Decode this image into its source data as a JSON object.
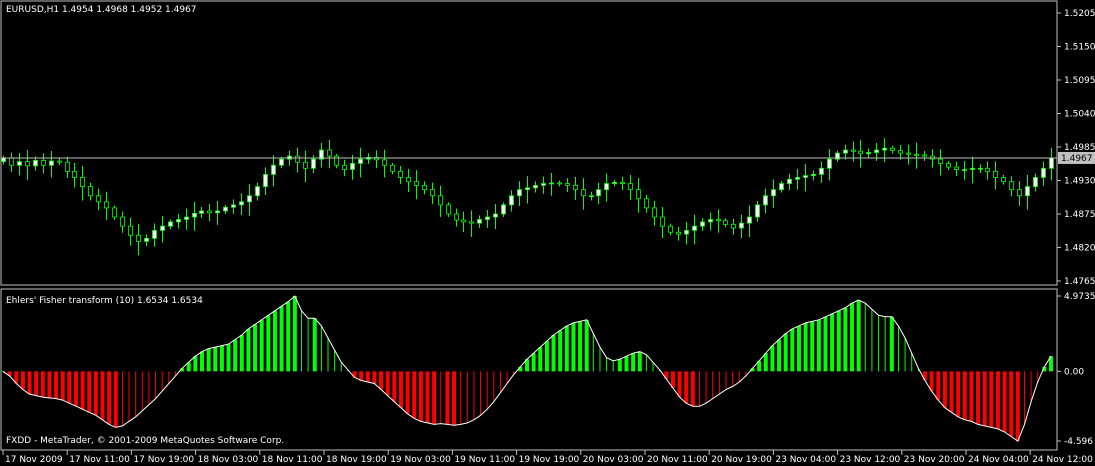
{
  "symbol_info": "EURUSD,H1  1.4954 1.4968 1.4952 1.4967",
  "indicator_info": "Ehlers' Fisher transform (10) 1.6534 1.6534",
  "copyright": "FXDD - MetaTrader, © 2001-2009 MetaQuotes Software Corp.",
  "current_price": "1.4967",
  "price_axis": [
    "1.5205",
    "1.5150",
    "1.5095",
    "1.5040",
    "1.4985",
    "1.4930",
    "1.4875",
    "1.4820",
    "1.4765"
  ],
  "indicator_axis": [
    "4.9735",
    "0.00",
    "-4.596"
  ],
  "time_axis": [
    "17 Nov 2009",
    "17 Nov 11:00",
    "17 Nov 19:00",
    "18 Nov 03:00",
    "18 Nov 11:00",
    "18 Nov 19:00",
    "19 Nov 03:00",
    "19 Nov 11:00",
    "19 Nov 19:00",
    "20 Nov 03:00",
    "20 Nov 11:00",
    "20 Nov 19:00",
    "23 Nov 04:00",
    "23 Nov 12:00",
    "23 Nov 20:00",
    "24 Nov 04:00",
    "24 Nov 12:00"
  ],
  "colors": {
    "background": "#000000",
    "frame": "#c0c0c0",
    "bull_candle": "#ffffff",
    "bear_candle": "#000000",
    "wick": "#00ff00",
    "price_line": "#c0c0c0",
    "hist_positive": "#00ff00",
    "hist_negative": "#ff0000",
    "signal_line": "#ffffff"
  },
  "chart_data": [
    {
      "type": "candlestick",
      "title": "EURUSD,H1",
      "ylim": [
        1.4765,
        1.5205
      ],
      "close_path": [
        1.4967,
        1.4955,
        1.4961,
        1.4954,
        1.4963,
        1.4955,
        1.4962,
        1.496,
        1.4945,
        1.4935,
        1.492,
        1.4905,
        1.4895,
        1.4885,
        1.487,
        1.4855,
        1.484,
        1.483,
        1.4835,
        1.4848,
        1.4855,
        1.4862,
        1.4866,
        1.487,
        1.4876,
        1.488,
        1.4877,
        1.488,
        1.4886,
        1.489,
        1.4895,
        1.4905,
        1.492,
        1.494,
        1.4955,
        1.4965,
        1.497,
        1.496,
        1.495,
        1.4965,
        1.498,
        1.497,
        1.4955,
        1.4948,
        1.4958,
        1.4965,
        1.4968,
        1.4964,
        1.4955,
        1.4945,
        1.4935,
        1.4928,
        1.4922,
        1.4915,
        1.4905,
        1.489,
        1.4875,
        1.4865,
        1.4862,
        1.486,
        1.4866,
        1.487,
        1.4875,
        1.489,
        1.4905,
        1.4915,
        1.4918,
        1.4922,
        1.4925,
        1.4926,
        1.4925,
        1.4922,
        1.4915,
        1.4905,
        1.4905,
        1.4915,
        1.4925,
        1.4927,
        1.4925,
        1.4915,
        1.49,
        1.4885,
        1.487,
        1.4855,
        1.4845,
        1.4842,
        1.4848,
        1.4855,
        1.4862,
        1.4866,
        1.4864,
        1.4858,
        1.4852,
        1.486,
        1.487,
        1.489,
        1.4905,
        1.4915,
        1.4925,
        1.4932,
        1.4935,
        1.4938,
        1.494,
        1.495,
        1.4965,
        1.4975,
        1.498,
        1.4978,
        1.4974,
        1.4976,
        1.498,
        1.4983,
        1.4979,
        1.4975,
        1.4973,
        1.4972,
        1.497,
        1.4965,
        1.4958,
        1.4952,
        1.4948,
        1.4948,
        1.495,
        1.495,
        1.4945,
        1.4935,
        1.4928,
        1.4915,
        1.4905,
        1.492,
        1.4935,
        1.495,
        1.4967
      ]
    },
    {
      "type": "bar",
      "title": "Ehlers' Fisher transform (10)",
      "ylim": [
        -4.596,
        4.9735
      ],
      "values": [
        0.0,
        -0.3,
        -0.8,
        -1.2,
        -1.5,
        -1.6,
        -1.7,
        -1.75,
        -1.8,
        -1.9,
        -2.1,
        -2.3,
        -2.5,
        -2.7,
        -2.9,
        -3.2,
        -3.5,
        -3.7,
        -3.6,
        -3.3,
        -3.0,
        -2.6,
        -2.2,
        -1.8,
        -1.3,
        -0.8,
        -0.3,
        0.2,
        0.6,
        1.0,
        1.3,
        1.5,
        1.6,
        1.7,
        1.8,
        2.1,
        2.4,
        2.8,
        3.1,
        3.4,
        3.7,
        4.0,
        4.3,
        4.6,
        4.97,
        4.0,
        3.5,
        3.5,
        3.0,
        2.2,
        1.4,
        0.6,
        0.1,
        -0.4,
        -0.6,
        -0.7,
        -0.8,
        -1.2,
        -1.6,
        -2.0,
        -2.4,
        -2.8,
        -3.1,
        -3.3,
        -3.4,
        -3.5,
        -3.45,
        -3.5,
        -3.55,
        -3.5,
        -3.4,
        -3.2,
        -2.9,
        -2.5,
        -2.0,
        -1.4,
        -0.8,
        -0.2,
        0.3,
        0.8,
        1.2,
        1.6,
        2.0,
        2.4,
        2.7,
        3.0,
        3.2,
        3.3,
        3.4,
        2.5,
        1.6,
        0.9,
        0.7,
        0.8,
        1.0,
        1.2,
        1.3,
        1.1,
        0.6,
        0.1,
        -0.5,
        -1.1,
        -1.7,
        -2.1,
        -2.3,
        -2.3,
        -2.1,
        -1.8,
        -1.5,
        -1.2,
        -1.0,
        -0.7,
        -0.3,
        0.2,
        0.7,
        1.2,
        1.7,
        2.1,
        2.5,
        2.8,
        3.0,
        3.2,
        3.3,
        3.4,
        3.6,
        3.8,
        4.0,
        4.2,
        4.5,
        4.7,
        4.5,
        4.1,
        3.7,
        3.6,
        3.6,
        3.0,
        2.2,
        1.2,
        0.2,
        -0.6,
        -1.3,
        -1.9,
        -2.4,
        -2.7,
        -3.0,
        -3.2,
        -3.3,
        -3.5,
        -3.6,
        -3.7,
        -3.8,
        -4.0,
        -4.3,
        -4.6,
        -3.5,
        -2.0,
        -0.7,
        0.3,
        1.0
      ]
    }
  ]
}
